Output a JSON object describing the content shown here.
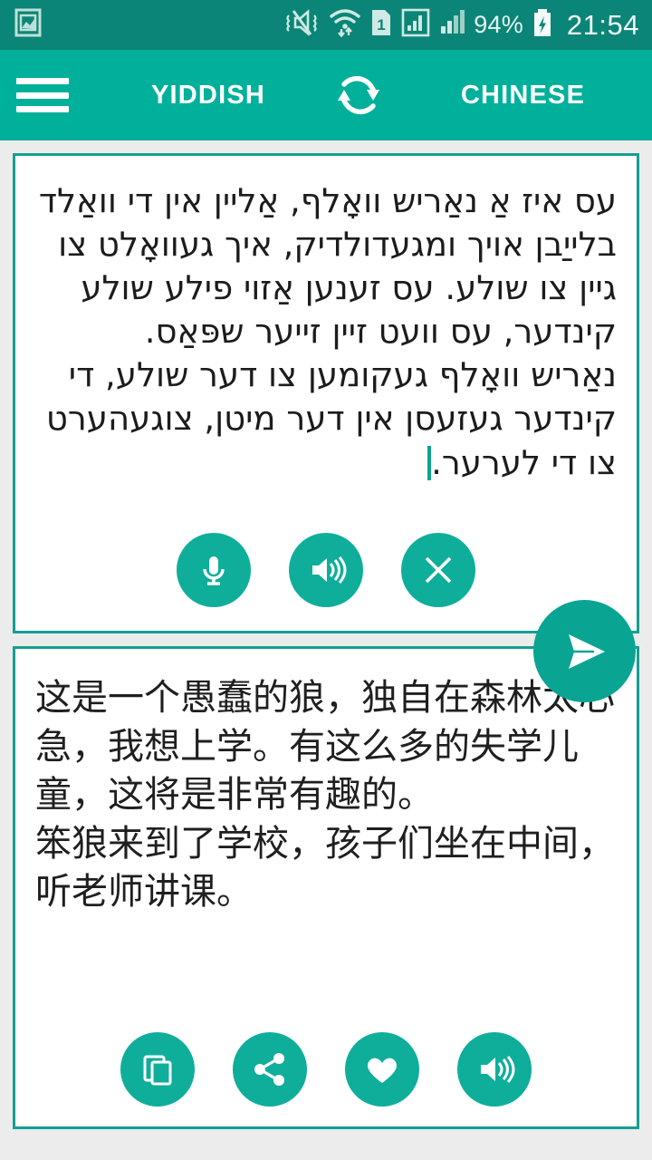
{
  "status_bar": {
    "gallery_icon": "image-icon",
    "icons": [
      "mute-vibrate-icon",
      "wifi-icon",
      "sim1-icon",
      "signal-sim1-icon",
      "signal-sim2-icon"
    ],
    "battery_percent": "94%",
    "battery_icon": "battery-charging-icon",
    "clock": "21:54",
    "bg_color": "#0b8577"
  },
  "toolbar": {
    "menu_icon": "hamburger-menu-icon",
    "source_language": "YIDDISH",
    "target_language": "CHINESE",
    "swap_icon": "swap-languages-icon",
    "bg_color": "#00b09b"
  },
  "source_card": {
    "text": "עס איז אַ נאַריש וואָלף, אַליין אין די וואַלד בלייַבן אויך ומגעדולדיק, איך געוואָלט צו גיין צו שולע. עס זענען אַזוי פילע שולע קינדער, עס וועט זיין זייער שפּאַס.\nנאַריש וואָלף געקומען צו דער שולע, די קינדער געזעסן אין דער מיטן, צוגעהערט צו די לערער.",
    "has_caret": true,
    "buttons": [
      {
        "name": "microphone-button",
        "icon": "microphone-icon"
      },
      {
        "name": "speak-button",
        "icon": "speaker-icon"
      },
      {
        "name": "clear-button",
        "icon": "close-icon"
      }
    ]
  },
  "translate_fab": {
    "name": "translate-send-button",
    "icon": "send-paper-plane-icon",
    "color": "#0aa493"
  },
  "target_card": {
    "text": "这是一个愚蠢的狼，独自在森林太心急，我想上学。有这么多的失学儿童，这将是非常有趣的。\n笨狼来到了学校，孩子们坐在中间，听老师讲课。",
    "buttons": [
      {
        "name": "copy-button",
        "icon": "copy-icon"
      },
      {
        "name": "share-button",
        "icon": "share-icon"
      },
      {
        "name": "favorite-button",
        "icon": "heart-icon"
      },
      {
        "name": "speak-translation-button",
        "icon": "speaker-icon"
      }
    ]
  },
  "theme": {
    "accent": "#0fae9b",
    "card_border": "#13a094",
    "page_bg": "#ececec"
  }
}
